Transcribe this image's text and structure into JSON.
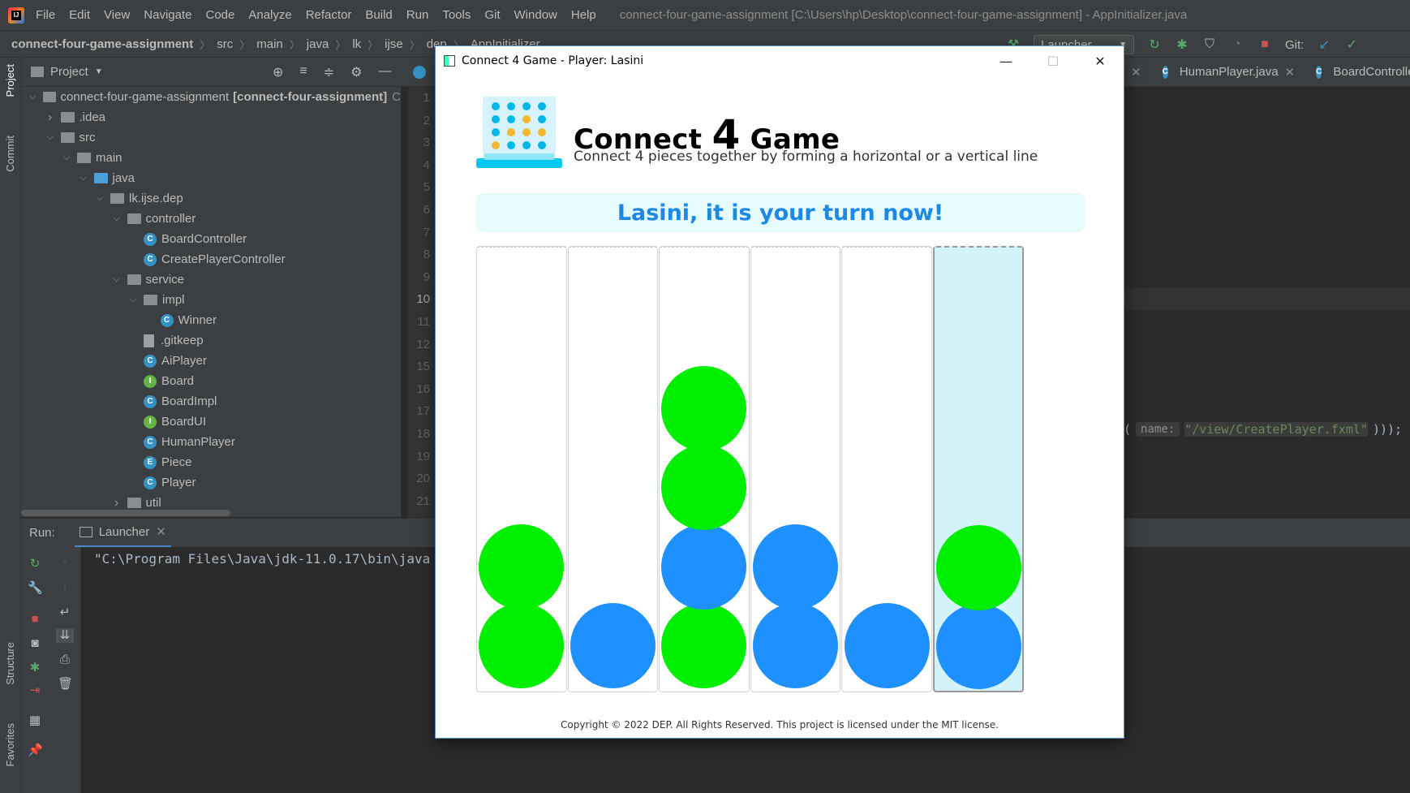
{
  "ide": {
    "menu": [
      "File",
      "Edit",
      "View",
      "Navigate",
      "Code",
      "Analyze",
      "Refactor",
      "Build",
      "Run",
      "Tools",
      "Git",
      "Window",
      "Help"
    ],
    "window_title": "connect-four-game-assignment [C:\\Users\\hp\\Desktop\\connect-four-game-assignment] - AppInitializer.java",
    "breadcrumbs": [
      "connect-four-game-assignment",
      "src",
      "main",
      "java",
      "lk",
      "ijse",
      "dep",
      "AppInitializer"
    ],
    "run_config": "Launcher",
    "git_label": "Git:",
    "left_stripe": [
      "Project",
      "Commit",
      "Structure",
      "Favorites"
    ],
    "project_panel_title": "Project",
    "tree": [
      {
        "label": "connect-four-game-assignment",
        "extra": "[connect-four-assignment]",
        "extra2": "C",
        "kind": "module",
        "indent": 0,
        "arrow": "v"
      },
      {
        "label": ".idea",
        "kind": "folder",
        "indent": 1,
        "arrow": ">"
      },
      {
        "label": "src",
        "kind": "folder",
        "indent": 1,
        "arrow": "v"
      },
      {
        "label": "main",
        "kind": "folder",
        "indent": 2,
        "arrow": "v"
      },
      {
        "label": "java",
        "kind": "folder-blue",
        "indent": 3,
        "arrow": "v"
      },
      {
        "label": "lk.ijse.dep",
        "kind": "folder",
        "indent": 4,
        "arrow": "v"
      },
      {
        "label": "controller",
        "kind": "folder",
        "indent": 5,
        "arrow": "v"
      },
      {
        "label": "BoardController",
        "kind": "class",
        "indent": 6,
        "arrow": ""
      },
      {
        "label": "CreatePlayerController",
        "kind": "class",
        "indent": 6,
        "arrow": ""
      },
      {
        "label": "service",
        "kind": "folder",
        "indent": 5,
        "arrow": "v"
      },
      {
        "label": "impl",
        "kind": "folder",
        "indent": 6,
        "arrow": "v"
      },
      {
        "label": "Winner",
        "kind": "class",
        "indent": 7,
        "arrow": ""
      },
      {
        "label": ".gitkeep",
        "kind": "file",
        "indent": 6,
        "arrow": ""
      },
      {
        "label": "AiPlayer",
        "kind": "class",
        "indent": 6,
        "arrow": ""
      },
      {
        "label": "Board",
        "kind": "interface",
        "indent": 6,
        "arrow": ""
      },
      {
        "label": "BoardImpl",
        "kind": "class",
        "indent": 6,
        "arrow": ""
      },
      {
        "label": "BoardUI",
        "kind": "interface",
        "indent": 6,
        "arrow": ""
      },
      {
        "label": "HumanPlayer",
        "kind": "class",
        "indent": 6,
        "arrow": ""
      },
      {
        "label": "Piece",
        "kind": "enum",
        "indent": 6,
        "arrow": ""
      },
      {
        "label": "Player",
        "kind": "class",
        "indent": 6,
        "arrow": ""
      },
      {
        "label": "util",
        "kind": "folder",
        "indent": 5,
        "arrow": ">"
      }
    ],
    "line_numbers": [
      "1",
      "2",
      "3",
      "4",
      "5",
      "6",
      "7",
      "8",
      "9",
      "10",
      "11",
      "12",
      "15",
      "16",
      "17",
      "18",
      "19",
      "20",
      "21"
    ],
    "editor_tabs": [
      "HumanPlayer.java",
      "BoardController."
    ],
    "code_hint_name": "name:",
    "code_hint_string": "\"/view/CreatePlayer.fxml\"",
    "code_hint_tail": ")));",
    "run_label": "Run:",
    "run_tab": "Launcher",
    "console_line": "\"C:\\Program Files\\Java\\jdk-11.0.17\\bin\\java"
  },
  "game": {
    "window_title": "Connect 4 Game - Player: Lasini",
    "title_prefix": "Connect",
    "title_number": "4",
    "title_suffix": "Game",
    "subtitle": "Connect 4 pieces together by forming a horizontal or a vertical line",
    "turn_message": "Lasini, it is your turn now!",
    "copyright": "Copyright © 2022 DEP. All Rights Reserved. This project is licensed under the MIT license.",
    "colors": {
      "green_piece": "#00ee00",
      "blue_piece": "#1e90ff",
      "turn_text": "#1e88e5",
      "banner_bg": "#e6fbfc",
      "hover_column": "#d3f3fb"
    },
    "hover_column": 5,
    "columns": [
      [
        "green",
        "green"
      ],
      [
        "blue"
      ],
      [
        "green",
        "blue",
        "green",
        "green"
      ],
      [
        "blue",
        "blue"
      ],
      [
        "blue"
      ],
      [
        "blue",
        "green"
      ]
    ]
  }
}
